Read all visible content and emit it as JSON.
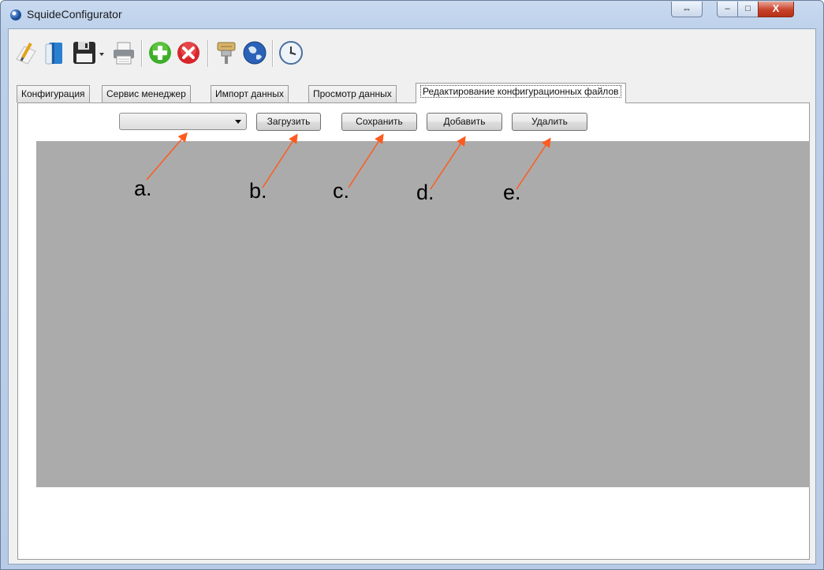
{
  "window": {
    "title": "SquideConfigurator",
    "swap_glyph": "⇔",
    "min_glyph": "‒",
    "max_glyph": "□",
    "close_glyph": "X"
  },
  "toolbar": {
    "icons": [
      "edit-icon",
      "book-icon",
      "save-icon",
      "dropdown-arrow-icon",
      "print-icon",
      "add-icon",
      "remove-icon",
      "connector-icon",
      "globe-icon",
      "clock-icon"
    ]
  },
  "tabs": [
    {
      "label": "Конфигурация"
    },
    {
      "label": "Сервис менеджер"
    },
    {
      "label": "Импорт данных"
    },
    {
      "label": "Просмотр данных"
    },
    {
      "label": "Редактирование конфигурационных файлов"
    }
  ],
  "editor": {
    "combo_value": "",
    "buttons": {
      "load": "Загрузить",
      "save": "Сохранить",
      "add": "Добавить",
      "delete": "Удалить"
    }
  },
  "annotations": [
    "a.",
    "b.",
    "c.",
    "d.",
    "e."
  ],
  "colors": {
    "arrow": "#ff5a1f",
    "grid_background": "#ababab"
  }
}
